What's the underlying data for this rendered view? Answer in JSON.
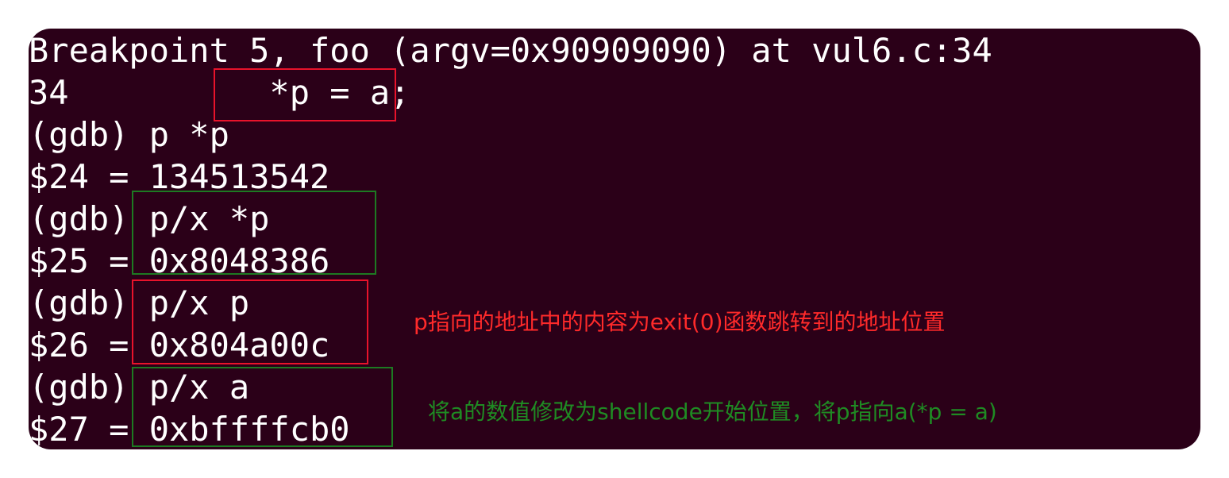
{
  "terminal": {
    "lines": [
      "Breakpoint 5, foo (argv=0x90909090) at vul6.c:34",
      "34          *p = a;",
      "(gdb) p *p",
      "$24 = 134513542",
      "(gdb) p/x *p",
      "$25 = 0x8048386",
      "(gdb) p/x p",
      "$26 = 0x804a00c",
      "(gdb) p/x a",
      "$27 = 0xbffffcb0"
    ],
    "background_color": "#2b0018",
    "text_color": "#ffffff"
  },
  "annotations": {
    "red_note": "p指向的地址中的内容为exit(0)函数跳转到的地址位置",
    "green_note": "将a的数值修改为shellcode开始位置，将p指向a(*p = a)",
    "red_color": "#e8132b",
    "green_color": "#1d7a22"
  }
}
